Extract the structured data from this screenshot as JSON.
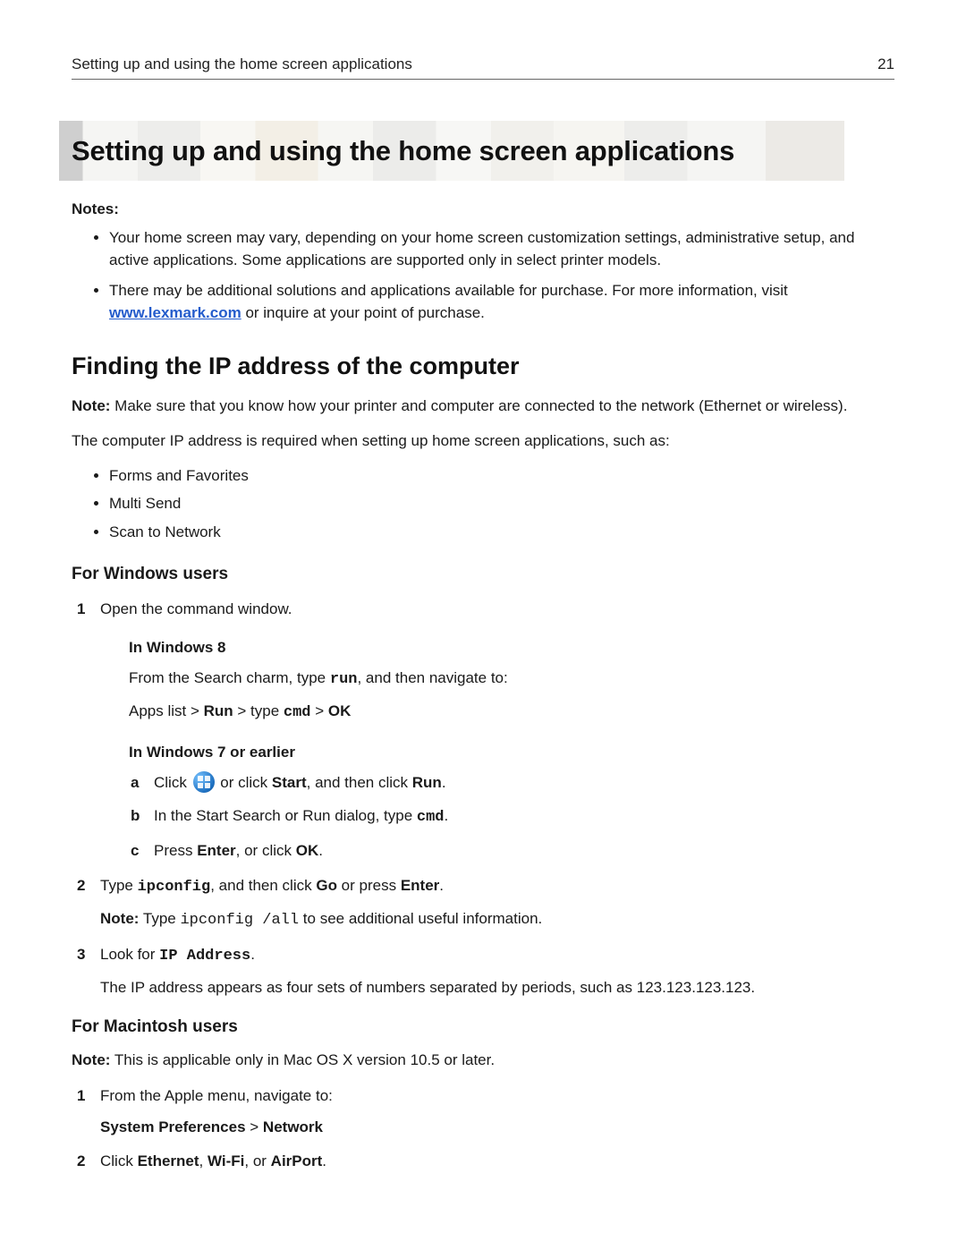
{
  "header": {
    "running": "Setting up and using the home screen applications",
    "pagenum": "21"
  },
  "title": "Setting up and using the home screen applications",
  "notes_label": "Notes:",
  "notes": {
    "item1": "Your home screen may vary, depending on your home screen customization settings, administrative setup, and active applications. Some applications are supported only in select printer models.",
    "item2_pre": "There may be additional solutions and applications available for purchase. For more information, visit ",
    "item2_link": "www.lexmark.com",
    "item2_post": " or inquire at your point of purchase."
  },
  "section_ip": "Finding the IP address of the computer",
  "note_prefix": "Note:",
  "ip_note": " Make sure that you know how your printer and computer are connected to the network (Ethernet or wireless).",
  "ip_intro": "The computer IP address is required when setting up home screen applications, such as:",
  "apps": {
    "a1": "Forms and Favorites",
    "a2": "Multi Send",
    "a3": "Scan to Network"
  },
  "windows_heading": "For Windows users",
  "steps_win": {
    "s1": "Open the command window.",
    "win8_title": "In Windows 8",
    "win8_p1_pre": "From the Search charm, type ",
    "win8_run": "run",
    "win8_p1_post": ", and then navigate to:",
    "win8_path_1": "Apps list > ",
    "win8_path_run": "Run",
    "win8_path_2": " > type ",
    "win8_path_cmd": "cmd",
    "win8_path_3": " > ",
    "win8_path_ok": "OK",
    "win7_title": "In Windows 7 or earlier",
    "win7_a_pre": "Click ",
    "win7_a_mid": " or click ",
    "win7_a_start": "Start",
    "win7_a_then": ", and then click ",
    "win7_a_run": "Run",
    "win7_a_end": ".",
    "win7_b_pre": "In the Start Search or Run dialog, type ",
    "win7_b_cmd": "cmd",
    "win7_b_end": ".",
    "win7_c_pre": "Press ",
    "win7_c_enter": "Enter",
    "win7_c_mid": ", or click ",
    "win7_c_ok": "OK",
    "win7_c_end": ".",
    "s2_pre": "Type ",
    "s2_ip": "ipconfig",
    "s2_mid": ", and then click ",
    "s2_go": "Go",
    "s2_or": " or press ",
    "s2_enter": "Enter",
    "s2_end": ".",
    "s2_note_pre": "Note:",
    "s2_note_mid1": " Type ",
    "s2_note_cmd": "ipconfig /all",
    "s2_note_mid2": " to see additional useful information.",
    "s3_pre": "Look for ",
    "s3_ip": "IP Address",
    "s3_end": ".",
    "s3_follow": "The IP address appears as four sets of numbers separated by periods, such as 123.123.123.123."
  },
  "mac_heading": "For Macintosh users",
  "mac_note": " This is applicable only in Mac OS X version 10.5 or later.",
  "steps_mac": {
    "s1": "From the Apple menu, navigate to:",
    "s1_path_a": "System Preferences",
    "s1_path_sep": " > ",
    "s1_path_b": "Network",
    "s2_pre": "Click ",
    "s2_eth": "Ethernet",
    "s2_c1": ", ",
    "s2_wifi": "Wi-Fi",
    "s2_c2": ", or ",
    "s2_air": "AirPort",
    "s2_end": "."
  }
}
